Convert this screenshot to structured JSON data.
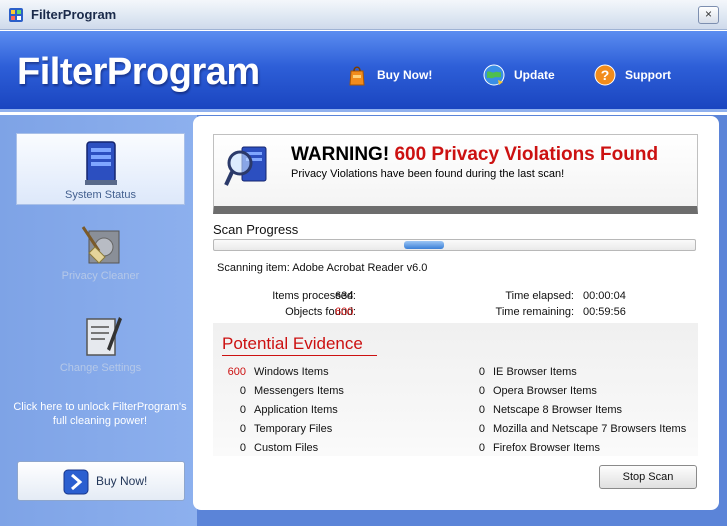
{
  "window": {
    "title": "FilterProgram",
    "close_glyph": "×"
  },
  "header": {
    "logo": "FilterProgram",
    "links": [
      {
        "label": "Buy Now!",
        "icon": "shopping-bag-icon"
      },
      {
        "label": "Update",
        "icon": "globe-icon"
      },
      {
        "label": "Support",
        "icon": "help-icon"
      }
    ]
  },
  "sidebar": {
    "items": [
      {
        "label": "System Status",
        "icon": "computer-icon",
        "state": "active"
      },
      {
        "label": "Privacy Cleaner",
        "icon": "broom-disk-icon",
        "state": "disabled"
      },
      {
        "label": "Change Settings",
        "icon": "settings-pen-icon",
        "state": "disabled"
      }
    ],
    "unlock_text": "Click here to unlock FilterProgram's full cleaning power!",
    "buy_label": "Buy Now!"
  },
  "warning": {
    "title_prefix": "WARNING!",
    "title_highlight": "600 Privacy Violations Found",
    "subtitle": "Privacy Violations have been found during the last scan!"
  },
  "scan": {
    "label": "Scan Progress",
    "progress_position": 0.43,
    "scanning_label": "Scanning item:",
    "scanning_item": "Adobe Acrobat Reader v6.0",
    "items_processed_label": "Items processed:",
    "items_processed": "634",
    "objects_found_label": "Objects found:",
    "objects_found": "600",
    "time_elapsed_label": "Time elapsed:",
    "time_elapsed": "00:00:04",
    "time_remaining_label": "Time remaining:",
    "time_remaining": "00:59:56"
  },
  "evidence": {
    "title": "Potential Evidence",
    "left": [
      {
        "count": "600",
        "label": "Windows Items",
        "highlight": true
      },
      {
        "count": "0",
        "label": "Messengers Items"
      },
      {
        "count": "0",
        "label": "Application Items"
      },
      {
        "count": "0",
        "label": "Temporary Files"
      },
      {
        "count": "0",
        "label": "Custom Files"
      }
    ],
    "right": [
      {
        "count": "0",
        "label": "IE Browser Items"
      },
      {
        "count": "0",
        "label": "Opera Browser Items"
      },
      {
        "count": "0",
        "label": "Netscape 8 Browser Items"
      },
      {
        "count": "0",
        "label": "Mozilla and Netscape 7 Browsers Items"
      },
      {
        "count": "0",
        "label": "Firefox Browser Items"
      }
    ]
  },
  "buttons": {
    "stop_scan": "Stop Scan"
  },
  "colors": {
    "header_blue": "#2e5fd8",
    "warning_red": "#cc1111",
    "sidebar_blue": "#7ea3e6"
  }
}
